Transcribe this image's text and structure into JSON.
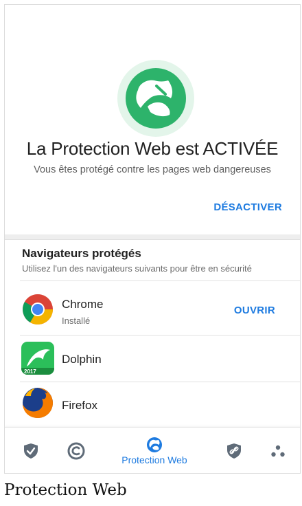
{
  "hero": {
    "title": "La Protection Web est ACTIVÉE",
    "subtitle": "Vous êtes protégé contre les pages web dangereuses",
    "deactivate_label": "DÉSACTIVER",
    "icon": "globe-shield-icon",
    "accent": "#2db36b"
  },
  "browsers": {
    "title": "Navigateurs protégés",
    "subtitle": "Utilisez l'un des navigateurs suivants pour être en sécurité",
    "items": [
      {
        "name": "Chrome",
        "status": "Installé",
        "action": "OUVRIR",
        "icon": "chrome-icon"
      },
      {
        "name": "Dolphin",
        "icon": "dolphin-icon",
        "badge": "2017"
      },
      {
        "name": "Firefox",
        "icon": "firefox-icon"
      }
    ]
  },
  "bottom_nav": {
    "active_label": "Protection Web",
    "items": [
      "shield-check-icon",
      "copyright-c-icon",
      "web-protection-icon",
      "shield-link-icon",
      "dots-icon"
    ],
    "accent": "#1e7be0"
  },
  "footer": {
    "caption": "Protection Web"
  }
}
